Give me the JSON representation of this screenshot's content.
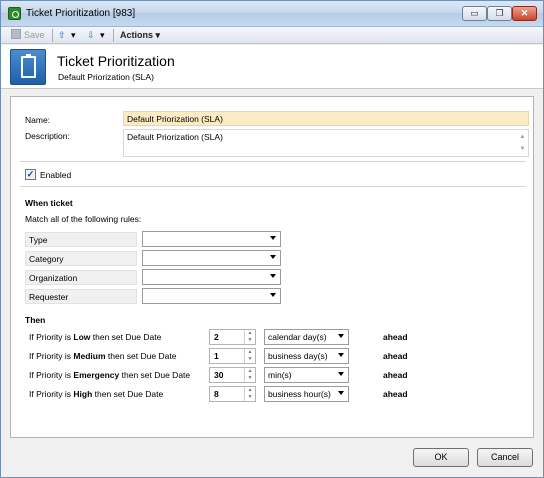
{
  "window": {
    "title": "Ticket Prioritization [983]",
    "controls": {
      "minimize": "▭",
      "maximize": "❐",
      "close": "✕"
    }
  },
  "toolbar": {
    "save_label": "Save",
    "up_arrow": "⇧",
    "down_arrow": "⇩",
    "dropdown_caret": "▾",
    "actions_label": "Actions"
  },
  "header": {
    "title": "Ticket Prioritization",
    "subtitle": "Default Priorization (SLA)"
  },
  "form": {
    "name_label": "Name:",
    "name_value": "Default Priorization (SLA)",
    "description_label": "Description:",
    "description_value": "Default Priorization (SLA)",
    "enabled_label": "Enabled",
    "enabled_checked": true
  },
  "when_ticket": {
    "heading": "When ticket",
    "match_text": "Match all of the following rules:",
    "rules": [
      {
        "label": "Type",
        "value": ""
      },
      {
        "label": "Category",
        "value": ""
      },
      {
        "label": "Organization",
        "value": ""
      },
      {
        "label": "Requester",
        "value": ""
      }
    ]
  },
  "then": {
    "heading": "Then",
    "prefix": "If Priority is",
    "suffix": "then set Due Date",
    "ahead_label": "ahead",
    "rows": [
      {
        "priority": "Low",
        "amount": "2",
        "unit": "calendar day(s)"
      },
      {
        "priority": "Medium",
        "amount": "1",
        "unit": "business day(s)"
      },
      {
        "priority": "Emergency",
        "amount": "30",
        "unit": "min(s)"
      },
      {
        "priority": "High",
        "amount": "8",
        "unit": "business hour(s)"
      }
    ]
  },
  "footer": {
    "ok_label": "OK",
    "cancel_label": "Cancel"
  },
  "colors": {
    "name_field_bg": "#fdebc4",
    "header_icon": "#2a6db8",
    "app_icon": "#2f8a2f"
  }
}
